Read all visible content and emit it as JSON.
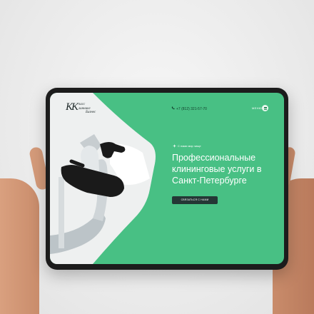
{
  "colors": {
    "accent": "#48c084",
    "cta_background": "#243735",
    "dark_text": "#1f2a2a"
  },
  "logo": {
    "mark": "КК",
    "lines": [
      "ласс",
      "линнинг",
      "Бизнес"
    ]
  },
  "header": {
    "phone_icon": "phone-icon",
    "phone": "+7 (812) 321-57-70",
    "menu_label": "МЕНЮ",
    "menu_icon": "hamburger-menu-icon"
  },
  "hero": {
    "tagline_icon": "sparkle-icon",
    "tagline": "С нами мир чище",
    "headline": "Профессиональные клининговые услуги в Санкт-Петербурге",
    "cta_label": "СВЯЗАТЬСЯ С НАМИ"
  }
}
